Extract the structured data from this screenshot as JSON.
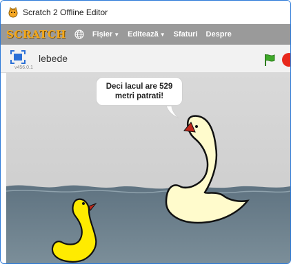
{
  "window": {
    "title": "Scratch 2 Offline Editor",
    "accent": "#2b79d8"
  },
  "menubar": {
    "logo": "SCRATCH",
    "items": [
      {
        "label": "Fișier",
        "has_dropdown": true
      },
      {
        "label": "Editează",
        "has_dropdown": true
      },
      {
        "label": "Sfaturi",
        "has_dropdown": false
      },
      {
        "label": "Despre",
        "has_dropdown": false
      }
    ],
    "dropdown_caret": "▼",
    "background": "#9a9a9a"
  },
  "toolbar": {
    "project_name": "lebede",
    "version": "v456.0.1",
    "icons": [
      "fullscreen-icon",
      "green-flag-icon",
      "stop-icon"
    ]
  },
  "stage": {
    "speech_bubble": {
      "line1": "Deci lacul are 529",
      "line2": "metri patrati!"
    },
    "sprites": [
      "big-swan",
      "small-yellow-swan"
    ],
    "colors": {
      "sky": "#d3d3d3",
      "water": "#6b7f8c",
      "big_swan": "#fffbcc",
      "small_swan": "#ffeb00",
      "beak": "#c0281c"
    }
  }
}
